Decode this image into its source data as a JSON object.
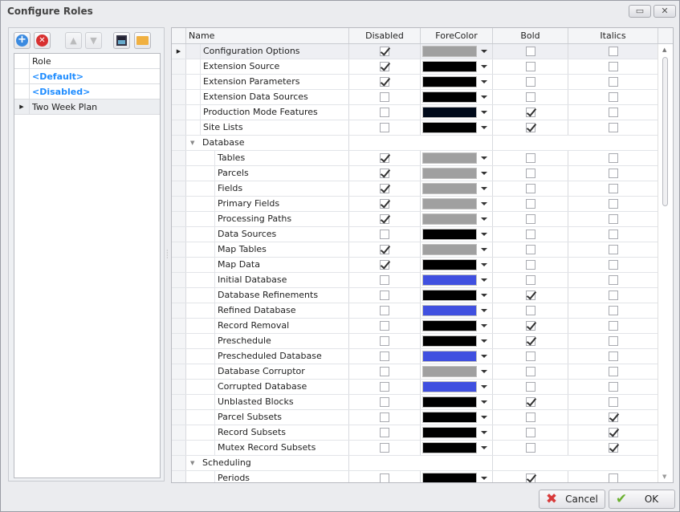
{
  "window": {
    "title": "Configure Roles"
  },
  "toolbar": {
    "add": "add-icon",
    "remove": "remove-icon",
    "up": "arrow-up-icon",
    "down": "arrow-down-icon",
    "save": "save-icon",
    "open": "folder-open-icon"
  },
  "roles": {
    "header": "Role",
    "items": [
      "<Default>",
      "<Disabled>",
      "Two Week Plan"
    ]
  },
  "grid": {
    "headers": {
      "name": "Name",
      "disabled": "Disabled",
      "forecolor": "ForeColor",
      "bold": "Bold",
      "italics": "Italics"
    },
    "colors": {
      "gray": "#a0a0a0",
      "black": "#000000",
      "navy": "#000a1a",
      "blue": "#4050e0"
    },
    "rows": [
      {
        "name": "Configuration Options",
        "level": 1,
        "disabled": true,
        "color": "gray",
        "bold": false,
        "italics": false
      },
      {
        "name": "Extension Source",
        "level": 1,
        "disabled": true,
        "color": "black",
        "bold": false,
        "italics": false
      },
      {
        "name": "Extension Parameters",
        "level": 1,
        "disabled": true,
        "color": "black",
        "bold": false,
        "italics": false
      },
      {
        "name": "Extension Data Sources",
        "level": 1,
        "disabled": false,
        "color": "black",
        "bold": false,
        "italics": false
      },
      {
        "name": "Production Mode Features",
        "level": 1,
        "disabled": false,
        "color": "navy",
        "bold": true,
        "italics": false
      },
      {
        "name": "Site Lists",
        "level": 1,
        "disabled": false,
        "color": "black",
        "bold": true,
        "italics": false
      },
      {
        "name": "Database",
        "group": true
      },
      {
        "name": "Tables",
        "level": 2,
        "disabled": true,
        "color": "gray",
        "bold": false,
        "italics": false
      },
      {
        "name": "Parcels",
        "level": 2,
        "disabled": true,
        "color": "gray",
        "bold": false,
        "italics": false
      },
      {
        "name": "Fields",
        "level": 2,
        "disabled": true,
        "color": "gray",
        "bold": false,
        "italics": false
      },
      {
        "name": "Primary Fields",
        "level": 2,
        "disabled": true,
        "color": "gray",
        "bold": false,
        "italics": false
      },
      {
        "name": "Processing Paths",
        "level": 2,
        "disabled": true,
        "color": "gray",
        "bold": false,
        "italics": false
      },
      {
        "name": "Data Sources",
        "level": 2,
        "disabled": false,
        "color": "black",
        "bold": false,
        "italics": false
      },
      {
        "name": "Map Tables",
        "level": 2,
        "disabled": true,
        "color": "gray",
        "bold": false,
        "italics": false
      },
      {
        "name": "Map Data",
        "level": 2,
        "disabled": true,
        "color": "black",
        "bold": false,
        "italics": false
      },
      {
        "name": "Initial Database",
        "level": 2,
        "disabled": false,
        "color": "blue",
        "bold": false,
        "italics": false
      },
      {
        "name": "Database Refinements",
        "level": 2,
        "disabled": false,
        "color": "black",
        "bold": true,
        "italics": false
      },
      {
        "name": "Refined Database",
        "level": 2,
        "disabled": false,
        "color": "blue",
        "bold": false,
        "italics": false
      },
      {
        "name": "Record Removal",
        "level": 2,
        "disabled": false,
        "color": "black",
        "bold": true,
        "italics": false
      },
      {
        "name": "Preschedule",
        "level": 2,
        "disabled": false,
        "color": "black",
        "bold": true,
        "italics": false
      },
      {
        "name": "Prescheduled Database",
        "level": 2,
        "disabled": false,
        "color": "blue",
        "bold": false,
        "italics": false
      },
      {
        "name": "Database Corruptor",
        "level": 2,
        "disabled": false,
        "color": "gray",
        "bold": false,
        "italics": false
      },
      {
        "name": "Corrupted Database",
        "level": 2,
        "disabled": false,
        "color": "blue",
        "bold": false,
        "italics": false
      },
      {
        "name": "Unblasted Blocks",
        "level": 2,
        "disabled": false,
        "color": "black",
        "bold": true,
        "italics": false
      },
      {
        "name": "Parcel Subsets",
        "level": 2,
        "disabled": false,
        "color": "black",
        "bold": false,
        "italics": true
      },
      {
        "name": "Record Subsets",
        "level": 2,
        "disabled": false,
        "color": "black",
        "bold": false,
        "italics": true
      },
      {
        "name": "Mutex Record Subsets",
        "level": 2,
        "disabled": false,
        "color": "black",
        "bold": false,
        "italics": true
      },
      {
        "name": "Scheduling",
        "group": true
      },
      {
        "name": "Periods",
        "level": 2,
        "disabled": false,
        "color": "black",
        "bold": true,
        "italics": false
      }
    ]
  },
  "buttons": {
    "cancel": "Cancel",
    "ok": "OK"
  }
}
